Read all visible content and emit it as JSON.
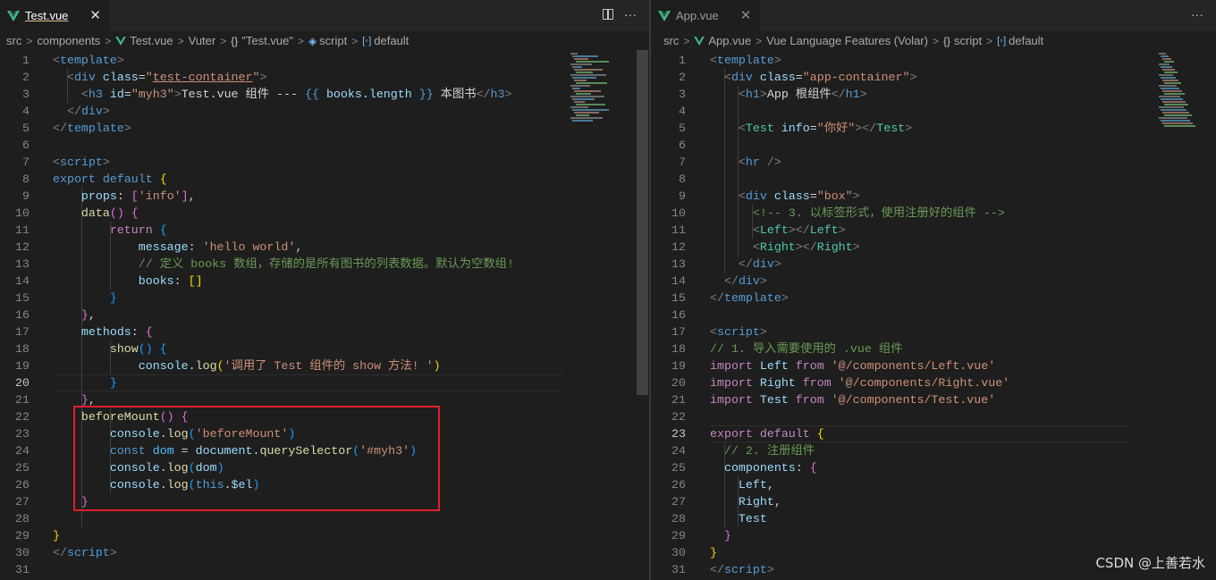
{
  "left": {
    "tab": {
      "name": "Test.vue",
      "close": "✕"
    },
    "actions": {
      "more": "···"
    },
    "breadcrumb": {
      "parts": [
        "src",
        "components",
        "Test.vue",
        "Vuter",
        "\"Test.vue\"",
        "script",
        "default"
      ],
      "braces": "{}"
    },
    "current_line": 20,
    "lines": [
      [
        [
          "t",
          "<"
        ],
        [
          "g",
          "template"
        ],
        [
          "t",
          ">"
        ]
      ],
      [
        [
          "p",
          "  "
        ],
        [
          "t",
          "<"
        ],
        [
          "g",
          "div"
        ],
        [
          "a",
          " class"
        ],
        [
          "p",
          "="
        ],
        [
          "s",
          "\""
        ],
        [
          "su",
          "test-container"
        ],
        [
          "s",
          "\""
        ],
        [
          "t",
          ">"
        ]
      ],
      [
        [
          "p",
          "    "
        ],
        [
          "t",
          "<"
        ],
        [
          "g",
          "h3"
        ],
        [
          "a",
          " id"
        ],
        [
          "p",
          "="
        ],
        [
          "s",
          "\"myh3\""
        ],
        [
          "t",
          ">"
        ],
        [
          "p",
          "Test.vue 组件 --- "
        ],
        [
          "b",
          "{{ "
        ],
        [
          "v",
          "books"
        ],
        [
          "p",
          "."
        ],
        [
          "v",
          "length"
        ],
        [
          "b",
          " }}"
        ],
        [
          "p",
          " 本图书"
        ],
        [
          "t",
          "</"
        ],
        [
          "g",
          "h3"
        ],
        [
          "t",
          ">"
        ]
      ],
      [
        [
          "p",
          "  "
        ],
        [
          "t",
          "</"
        ],
        [
          "g",
          "div"
        ],
        [
          "t",
          ">"
        ]
      ],
      [
        [
          "t",
          "</"
        ],
        [
          "g",
          "template"
        ],
        [
          "t",
          ">"
        ]
      ],
      [],
      [
        [
          "t",
          "<"
        ],
        [
          "g",
          "script"
        ],
        [
          "t",
          ">"
        ]
      ],
      [
        [
          "k",
          "export"
        ],
        [
          "p",
          " "
        ],
        [
          "k",
          "default"
        ],
        [
          "p",
          " "
        ],
        [
          "y",
          "{"
        ]
      ],
      [
        [
          "p",
          "    "
        ],
        [
          "v",
          "props"
        ],
        [
          "p",
          ": "
        ],
        [
          "m",
          "["
        ],
        [
          "s",
          "'info'"
        ],
        [
          "m",
          "]"
        ],
        [
          "p",
          ","
        ]
      ],
      [
        [
          "p",
          "    "
        ],
        [
          "f",
          "data"
        ],
        [
          "m",
          "()"
        ],
        [
          "p",
          " "
        ],
        [
          "m",
          "{"
        ]
      ],
      [
        [
          "p",
          "        "
        ],
        [
          "c",
          "return"
        ],
        [
          "p",
          " "
        ],
        [
          "n",
          "{"
        ]
      ],
      [
        [
          "p",
          "            "
        ],
        [
          "v",
          "message"
        ],
        [
          "p",
          ": "
        ],
        [
          "s",
          "'hello world'"
        ],
        [
          "p",
          ","
        ]
      ],
      [
        [
          "p",
          "            "
        ],
        [
          "o",
          "// 定义 books 数组，存储的是所有图书的列表数据。默认为空数组!"
        ]
      ],
      [
        [
          "p",
          "            "
        ],
        [
          "v",
          "books"
        ],
        [
          "p",
          ": "
        ],
        [
          "y",
          "[]"
        ]
      ],
      [
        [
          "p",
          "        "
        ],
        [
          "n",
          "}"
        ]
      ],
      [
        [
          "p",
          "    "
        ],
        [
          "m",
          "}"
        ],
        [
          "p",
          ","
        ]
      ],
      [
        [
          "p",
          "    "
        ],
        [
          "v",
          "methods"
        ],
        [
          "p",
          ": "
        ],
        [
          "m",
          "{"
        ]
      ],
      [
        [
          "p",
          "        "
        ],
        [
          "f",
          "show"
        ],
        [
          "n",
          "()"
        ],
        [
          "p",
          " "
        ],
        [
          "n",
          "{"
        ]
      ],
      [
        [
          "p",
          "            "
        ],
        [
          "v",
          "console"
        ],
        [
          "p",
          "."
        ],
        [
          "f",
          "log"
        ],
        [
          "y",
          "("
        ],
        [
          "s",
          "'调用了 Test 组件的 show 方法! '"
        ],
        [
          "y",
          ")"
        ]
      ],
      [
        [
          "p",
          "        "
        ],
        [
          "n",
          "}"
        ]
      ],
      [
        [
          "p",
          "    "
        ],
        [
          "m",
          "}"
        ],
        [
          "p",
          ","
        ]
      ],
      [
        [
          "p",
          "    "
        ],
        [
          "f",
          "beforeMount"
        ],
        [
          "m",
          "()"
        ],
        [
          "p",
          " "
        ],
        [
          "m",
          "{"
        ]
      ],
      [
        [
          "p",
          "        "
        ],
        [
          "v",
          "console"
        ],
        [
          "p",
          "."
        ],
        [
          "f",
          "log"
        ],
        [
          "n",
          "("
        ],
        [
          "s",
          "'beforeMount'"
        ],
        [
          "n",
          ")"
        ]
      ],
      [
        [
          "p",
          "        "
        ],
        [
          "k",
          "const"
        ],
        [
          "p",
          " "
        ],
        [
          "x",
          "dom"
        ],
        [
          "p",
          " = "
        ],
        [
          "v",
          "document"
        ],
        [
          "p",
          "."
        ],
        [
          "f",
          "querySelector"
        ],
        [
          "n",
          "("
        ],
        [
          "s",
          "'#myh3'"
        ],
        [
          "n",
          ")"
        ]
      ],
      [
        [
          "p",
          "        "
        ],
        [
          "v",
          "console"
        ],
        [
          "p",
          "."
        ],
        [
          "f",
          "log"
        ],
        [
          "n",
          "("
        ],
        [
          "v",
          "dom"
        ],
        [
          "n",
          ")"
        ]
      ],
      [
        [
          "p",
          "        "
        ],
        [
          "v",
          "console"
        ],
        [
          "p",
          "."
        ],
        [
          "f",
          "log"
        ],
        [
          "n",
          "("
        ],
        [
          "k",
          "this"
        ],
        [
          "p",
          "."
        ],
        [
          "v",
          "$el"
        ],
        [
          "n",
          ")"
        ]
      ],
      [
        [
          "p",
          "    "
        ],
        [
          "m",
          "}"
        ]
      ],
      [],
      [
        [
          "y",
          "}"
        ]
      ],
      [
        [
          "t",
          "</"
        ],
        [
          "g",
          "script"
        ],
        [
          "t",
          ">"
        ]
      ],
      []
    ]
  },
  "right": {
    "tab": {
      "name": "App.vue",
      "close": "✕"
    },
    "actions": {
      "more": "···"
    },
    "breadcrumb": {
      "parts": [
        "src",
        "App.vue",
        "Vue Language Features (Volar)",
        "script",
        "default"
      ],
      "braces": "{}"
    },
    "current_line": 23,
    "lines": [
      [
        [
          "t",
          "<"
        ],
        [
          "g",
          "template"
        ],
        [
          "t",
          ">"
        ]
      ],
      [
        [
          "p",
          "  "
        ],
        [
          "t",
          "<"
        ],
        [
          "g",
          "div"
        ],
        [
          "a",
          " class"
        ],
        [
          "p",
          "="
        ],
        [
          "s",
          "\"app-container\""
        ],
        [
          "t",
          ">"
        ]
      ],
      [
        [
          "p",
          "    "
        ],
        [
          "t",
          "<"
        ],
        [
          "g",
          "h1"
        ],
        [
          "t",
          ">"
        ],
        [
          "p",
          "App 根组件"
        ],
        [
          "t",
          "</"
        ],
        [
          "g",
          "h1"
        ],
        [
          "t",
          ">"
        ]
      ],
      [],
      [
        [
          "p",
          "    "
        ],
        [
          "t",
          "<"
        ],
        [
          "e",
          "Test"
        ],
        [
          "a",
          " info"
        ],
        [
          "p",
          "="
        ],
        [
          "s",
          "\"你好\""
        ],
        [
          "t",
          "></"
        ],
        [
          "e",
          "Test"
        ],
        [
          "t",
          ">"
        ]
      ],
      [],
      [
        [
          "p",
          "    "
        ],
        [
          "t",
          "<"
        ],
        [
          "g",
          "hr"
        ],
        [
          "p",
          " "
        ],
        [
          "t",
          "/>"
        ]
      ],
      [],
      [
        [
          "p",
          "    "
        ],
        [
          "t",
          "<"
        ],
        [
          "g",
          "div"
        ],
        [
          "a",
          " class"
        ],
        [
          "p",
          "="
        ],
        [
          "s",
          "\"box\""
        ],
        [
          "t",
          ">"
        ]
      ],
      [
        [
          "p",
          "      "
        ],
        [
          "o",
          "<!-- 3. 以标签形式，使用注册好的组件 -->"
        ]
      ],
      [
        [
          "p",
          "      "
        ],
        [
          "t",
          "<"
        ],
        [
          "e",
          "Left"
        ],
        [
          "t",
          "></"
        ],
        [
          "e",
          "Left"
        ],
        [
          "t",
          ">"
        ]
      ],
      [
        [
          "p",
          "      "
        ],
        [
          "t",
          "<"
        ],
        [
          "e",
          "Right"
        ],
        [
          "t",
          "></"
        ],
        [
          "e",
          "Right"
        ],
        [
          "t",
          ">"
        ]
      ],
      [
        [
          "p",
          "    "
        ],
        [
          "t",
          "</"
        ],
        [
          "g",
          "div"
        ],
        [
          "t",
          ">"
        ]
      ],
      [
        [
          "p",
          "  "
        ],
        [
          "t",
          "</"
        ],
        [
          "g",
          "div"
        ],
        [
          "t",
          ">"
        ]
      ],
      [
        [
          "t",
          "</"
        ],
        [
          "g",
          "template"
        ],
        [
          "t",
          ">"
        ]
      ],
      [],
      [
        [
          "t",
          "<"
        ],
        [
          "g",
          "script"
        ],
        [
          "t",
          ">"
        ]
      ],
      [
        [
          "o",
          "// 1. 导入需要使用的 .vue 组件"
        ]
      ],
      [
        [
          "c",
          "import"
        ],
        [
          "p",
          " "
        ],
        [
          "v",
          "Left"
        ],
        [
          "p",
          " "
        ],
        [
          "c",
          "from"
        ],
        [
          "p",
          " "
        ],
        [
          "s",
          "'@/components/Left.vue'"
        ]
      ],
      [
        [
          "c",
          "import"
        ],
        [
          "p",
          " "
        ],
        [
          "v",
          "Right"
        ],
        [
          "p",
          " "
        ],
        [
          "c",
          "from"
        ],
        [
          "p",
          " "
        ],
        [
          "s",
          "'@/components/Right.vue'"
        ]
      ],
      [
        [
          "c",
          "import"
        ],
        [
          "p",
          " "
        ],
        [
          "v",
          "Test"
        ],
        [
          "p",
          " "
        ],
        [
          "c",
          "from"
        ],
        [
          "p",
          " "
        ],
        [
          "s",
          "'@/components/Test.vue'"
        ]
      ],
      [],
      [
        [
          "c",
          "export"
        ],
        [
          "p",
          " "
        ],
        [
          "c",
          "default"
        ],
        [
          "p",
          " "
        ],
        [
          "y",
          "{"
        ]
      ],
      [
        [
          "p",
          "  "
        ],
        [
          "o",
          "// 2. 注册组件"
        ]
      ],
      [
        [
          "p",
          "  "
        ],
        [
          "v",
          "components"
        ],
        [
          "p",
          ": "
        ],
        [
          "m",
          "{"
        ]
      ],
      [
        [
          "p",
          "    "
        ],
        [
          "v",
          "Left"
        ],
        [
          "p",
          ","
        ]
      ],
      [
        [
          "p",
          "    "
        ],
        [
          "v",
          "Right"
        ],
        [
          "p",
          ","
        ]
      ],
      [
        [
          "p",
          "    "
        ],
        [
          "v",
          "Test"
        ]
      ],
      [
        [
          "p",
          "  "
        ],
        [
          "m",
          "}"
        ]
      ],
      [
        [
          "y",
          "}"
        ]
      ],
      [
        [
          "t",
          "</"
        ],
        [
          "g",
          "script"
        ],
        [
          "t",
          ">"
        ]
      ]
    ]
  },
  "watermark": "CSDN @上善若水",
  "colors": {
    "t": "#808080",
    "g": "#569cd6",
    "a": "#9cdcfe",
    "s": "#ce9178",
    "su": "#ce9178",
    "p": "#d4d4d4",
    "b": "#569cd6",
    "v": "#9cdcfe",
    "k": "#569cd6",
    "c": "#c586c0",
    "f": "#dcdcaa",
    "m": "#da70d6",
    "y": "#ffd700",
    "n": "#179fff",
    "o": "#6a9955",
    "x": "#4fc1ff",
    "e": "#4ec9b0",
    "red_box": "#e0202a"
  }
}
